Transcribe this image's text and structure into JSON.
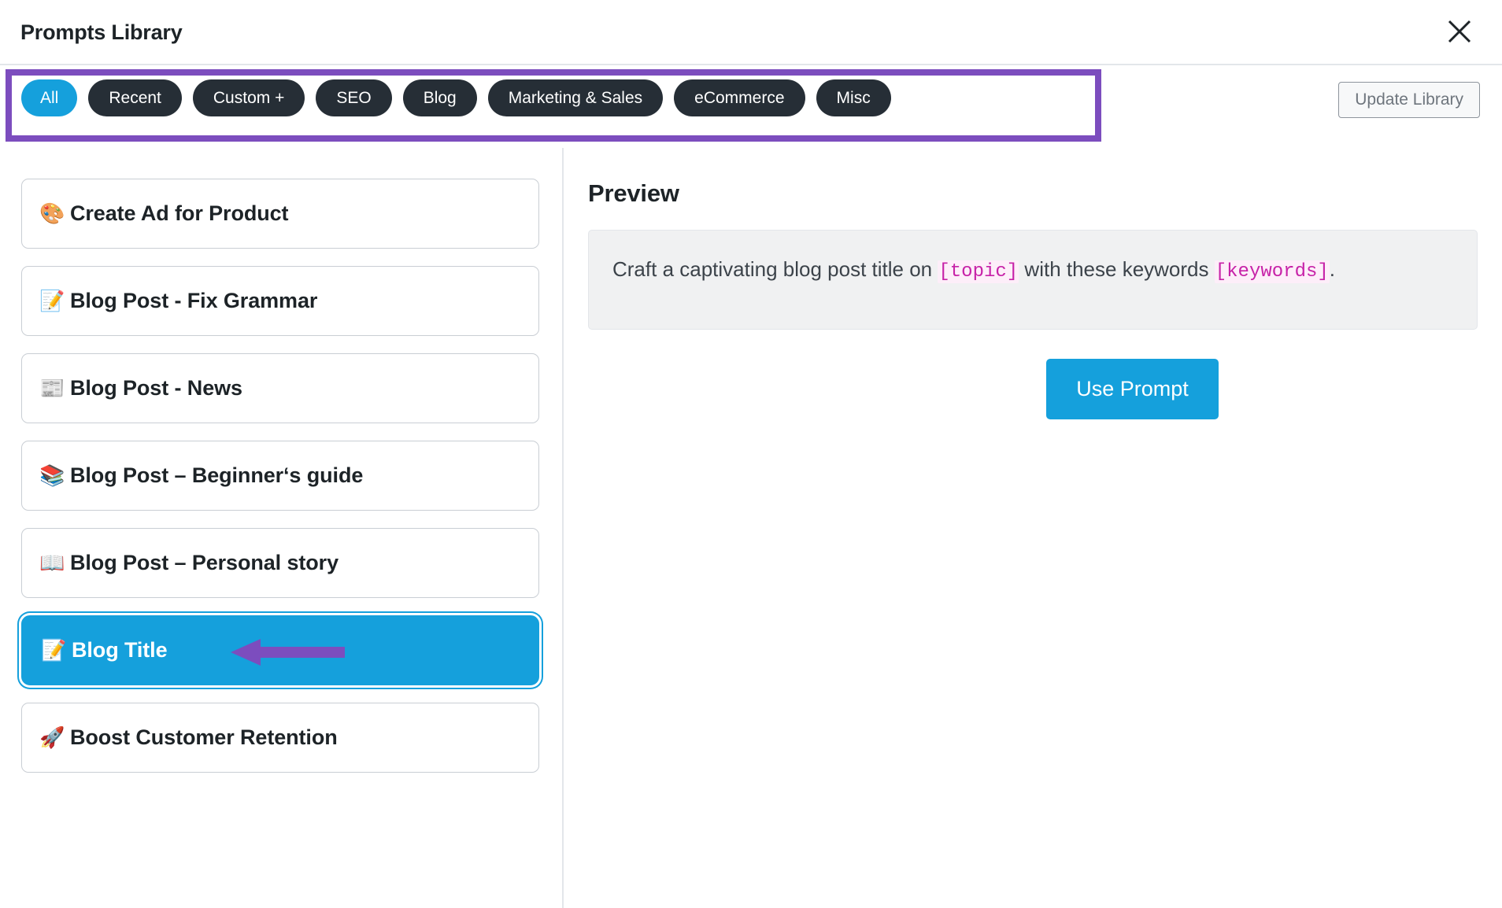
{
  "header": {
    "title": "Prompts Library",
    "close_icon": "close-icon"
  },
  "toolbar": {
    "tabs": [
      {
        "label": "All",
        "active": true
      },
      {
        "label": "Recent",
        "active": false
      },
      {
        "label": "Custom +",
        "active": false
      },
      {
        "label": "SEO",
        "active": false
      },
      {
        "label": "Blog",
        "active": false
      },
      {
        "label": "Marketing & Sales",
        "active": false
      },
      {
        "label": "eCommerce",
        "active": false
      },
      {
        "label": "Misc",
        "active": false
      }
    ],
    "update_library_label": "Update Library"
  },
  "prompt_list": {
    "items": [
      {
        "emoji": "🎨",
        "icon_name": "palette-icon",
        "label": "Create Ad for Product",
        "selected": false
      },
      {
        "emoji": "📝",
        "icon_name": "memo-icon",
        "label": "Blog Post - Fix Grammar",
        "selected": false
      },
      {
        "emoji": "📰",
        "icon_name": "newspaper-icon",
        "label": "Blog Post - News",
        "selected": false
      },
      {
        "emoji": "📚",
        "icon_name": "books-icon",
        "label": "Blog Post – Beginner‘s guide",
        "selected": false
      },
      {
        "emoji": "📖",
        "icon_name": "open-book-icon",
        "label": "Blog Post – Personal story",
        "selected": false
      },
      {
        "emoji": "📝",
        "icon_name": "memo-icon",
        "label": "Blog Title",
        "selected": true
      },
      {
        "emoji": "🚀",
        "icon_name": "rocket-icon",
        "label": "Boost Customer Retention",
        "selected": false
      }
    ]
  },
  "preview": {
    "heading": "Preview",
    "text_part_1": "Craft a captivating blog post title on ",
    "token_1": "[topic]",
    "text_part_2": " with these keywords ",
    "token_2": "[keywords]",
    "text_part_3": ".",
    "use_prompt_label": "Use Prompt"
  },
  "annotations": {
    "highlight_box_color": "#7c4dbe",
    "arrow_color": "#7c4dbe"
  },
  "colors": {
    "accent_blue": "#15a0dc",
    "tab_dark": "#262e36",
    "token_pink": "#c722a8",
    "token_bg": "#fdeef9",
    "panel_gray": "#f0f1f2",
    "border_gray": "#c9ced4"
  }
}
